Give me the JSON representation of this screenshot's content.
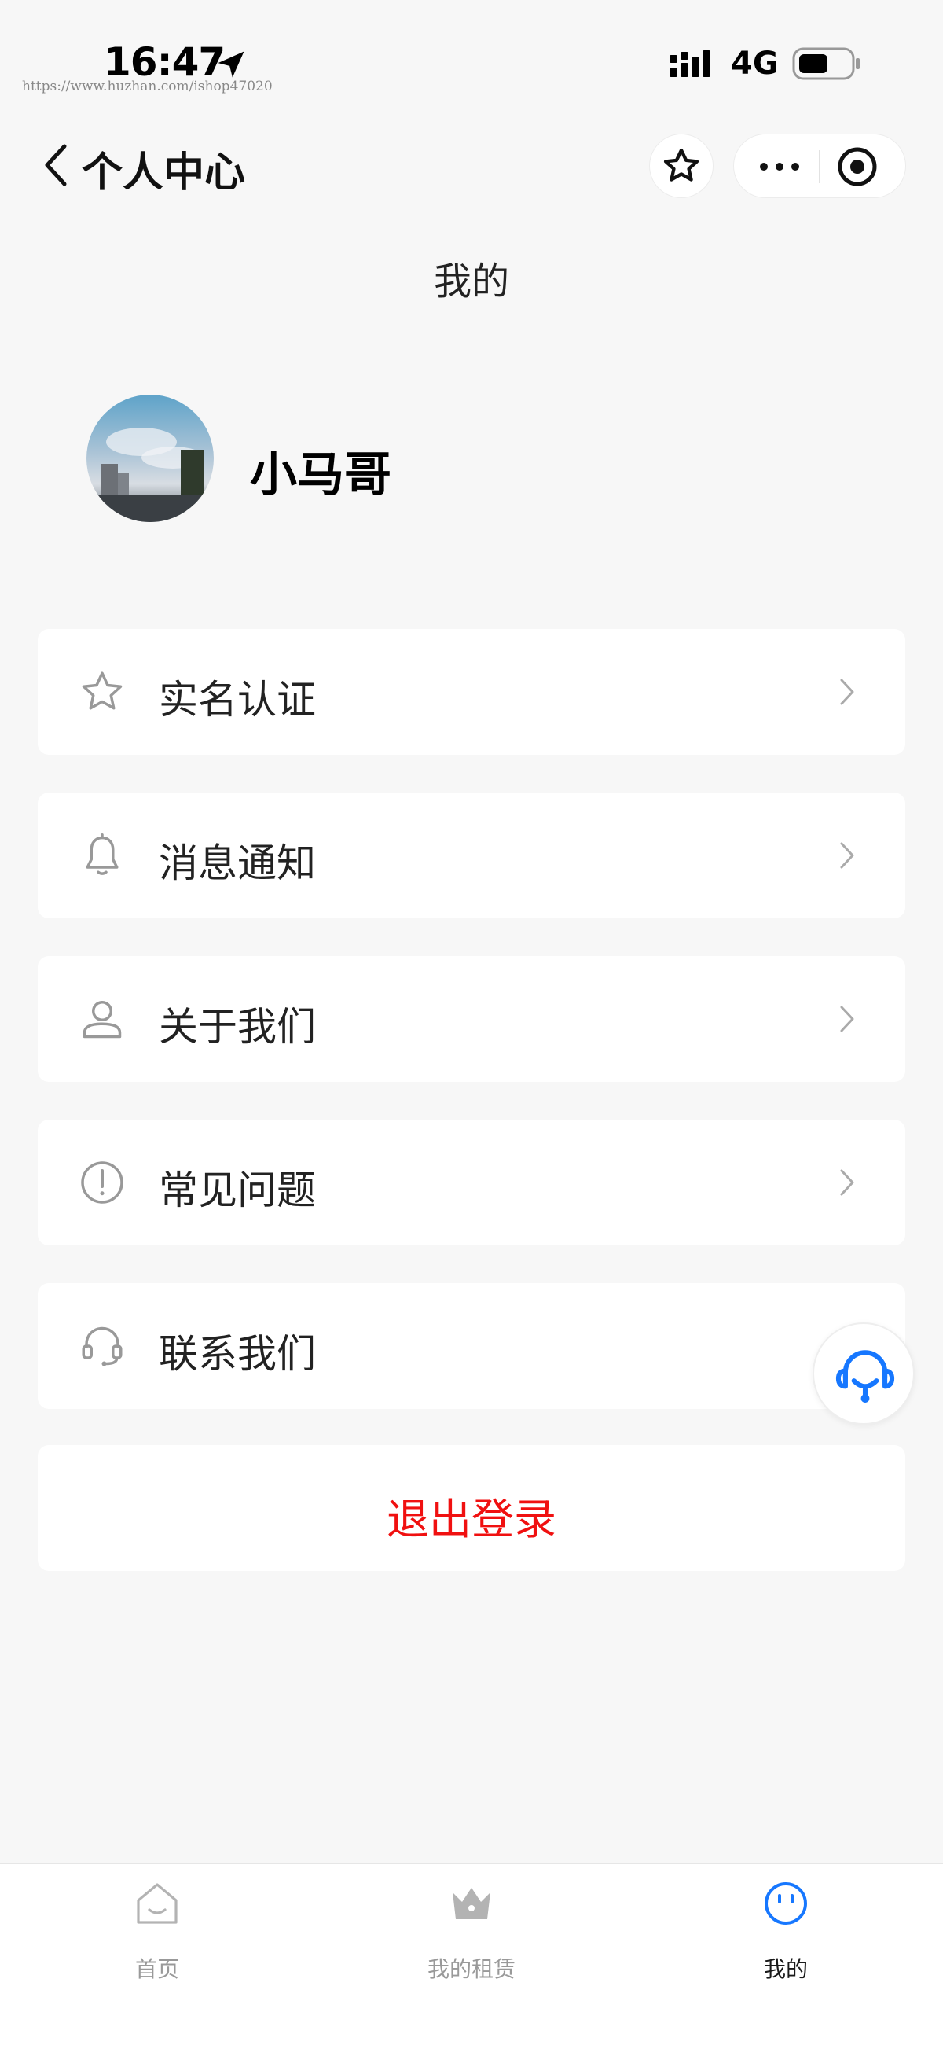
{
  "status_bar": {
    "time": "16:47",
    "network": "4G",
    "watermark": "https://www.huzhan.com/ishop47020"
  },
  "nav": {
    "back_icon": "chevron-left-icon",
    "title": "个人中心",
    "favorite_icon": "star-icon",
    "more_icon": "more-dots-icon",
    "close_icon": "target-icon"
  },
  "page": {
    "title": "我的"
  },
  "profile": {
    "username": "小马哥"
  },
  "menu": {
    "items": [
      {
        "icon": "star-icon",
        "label": "实名认证",
        "has_chevron": true
      },
      {
        "icon": "bell-icon",
        "label": "消息通知",
        "has_chevron": true
      },
      {
        "icon": "user-icon",
        "label": "关于我们",
        "has_chevron": true
      },
      {
        "icon": "info-circle-icon",
        "label": "常见问题",
        "has_chevron": true
      },
      {
        "icon": "headset-icon",
        "label": "联系我们",
        "has_chevron": false
      }
    ]
  },
  "logout": {
    "label": "退出登录",
    "color": "#f01010"
  },
  "service_button": {
    "icon": "customer-service-icon",
    "color": "#1677ff"
  },
  "tabbar": {
    "active_color": "#1677ff",
    "tabs": [
      {
        "icon": "home-icon",
        "label": "首页",
        "active": false
      },
      {
        "icon": "crown-icon",
        "label": "我的租赁",
        "active": false
      },
      {
        "icon": "smile-icon",
        "label": "我的",
        "active": true
      }
    ]
  }
}
